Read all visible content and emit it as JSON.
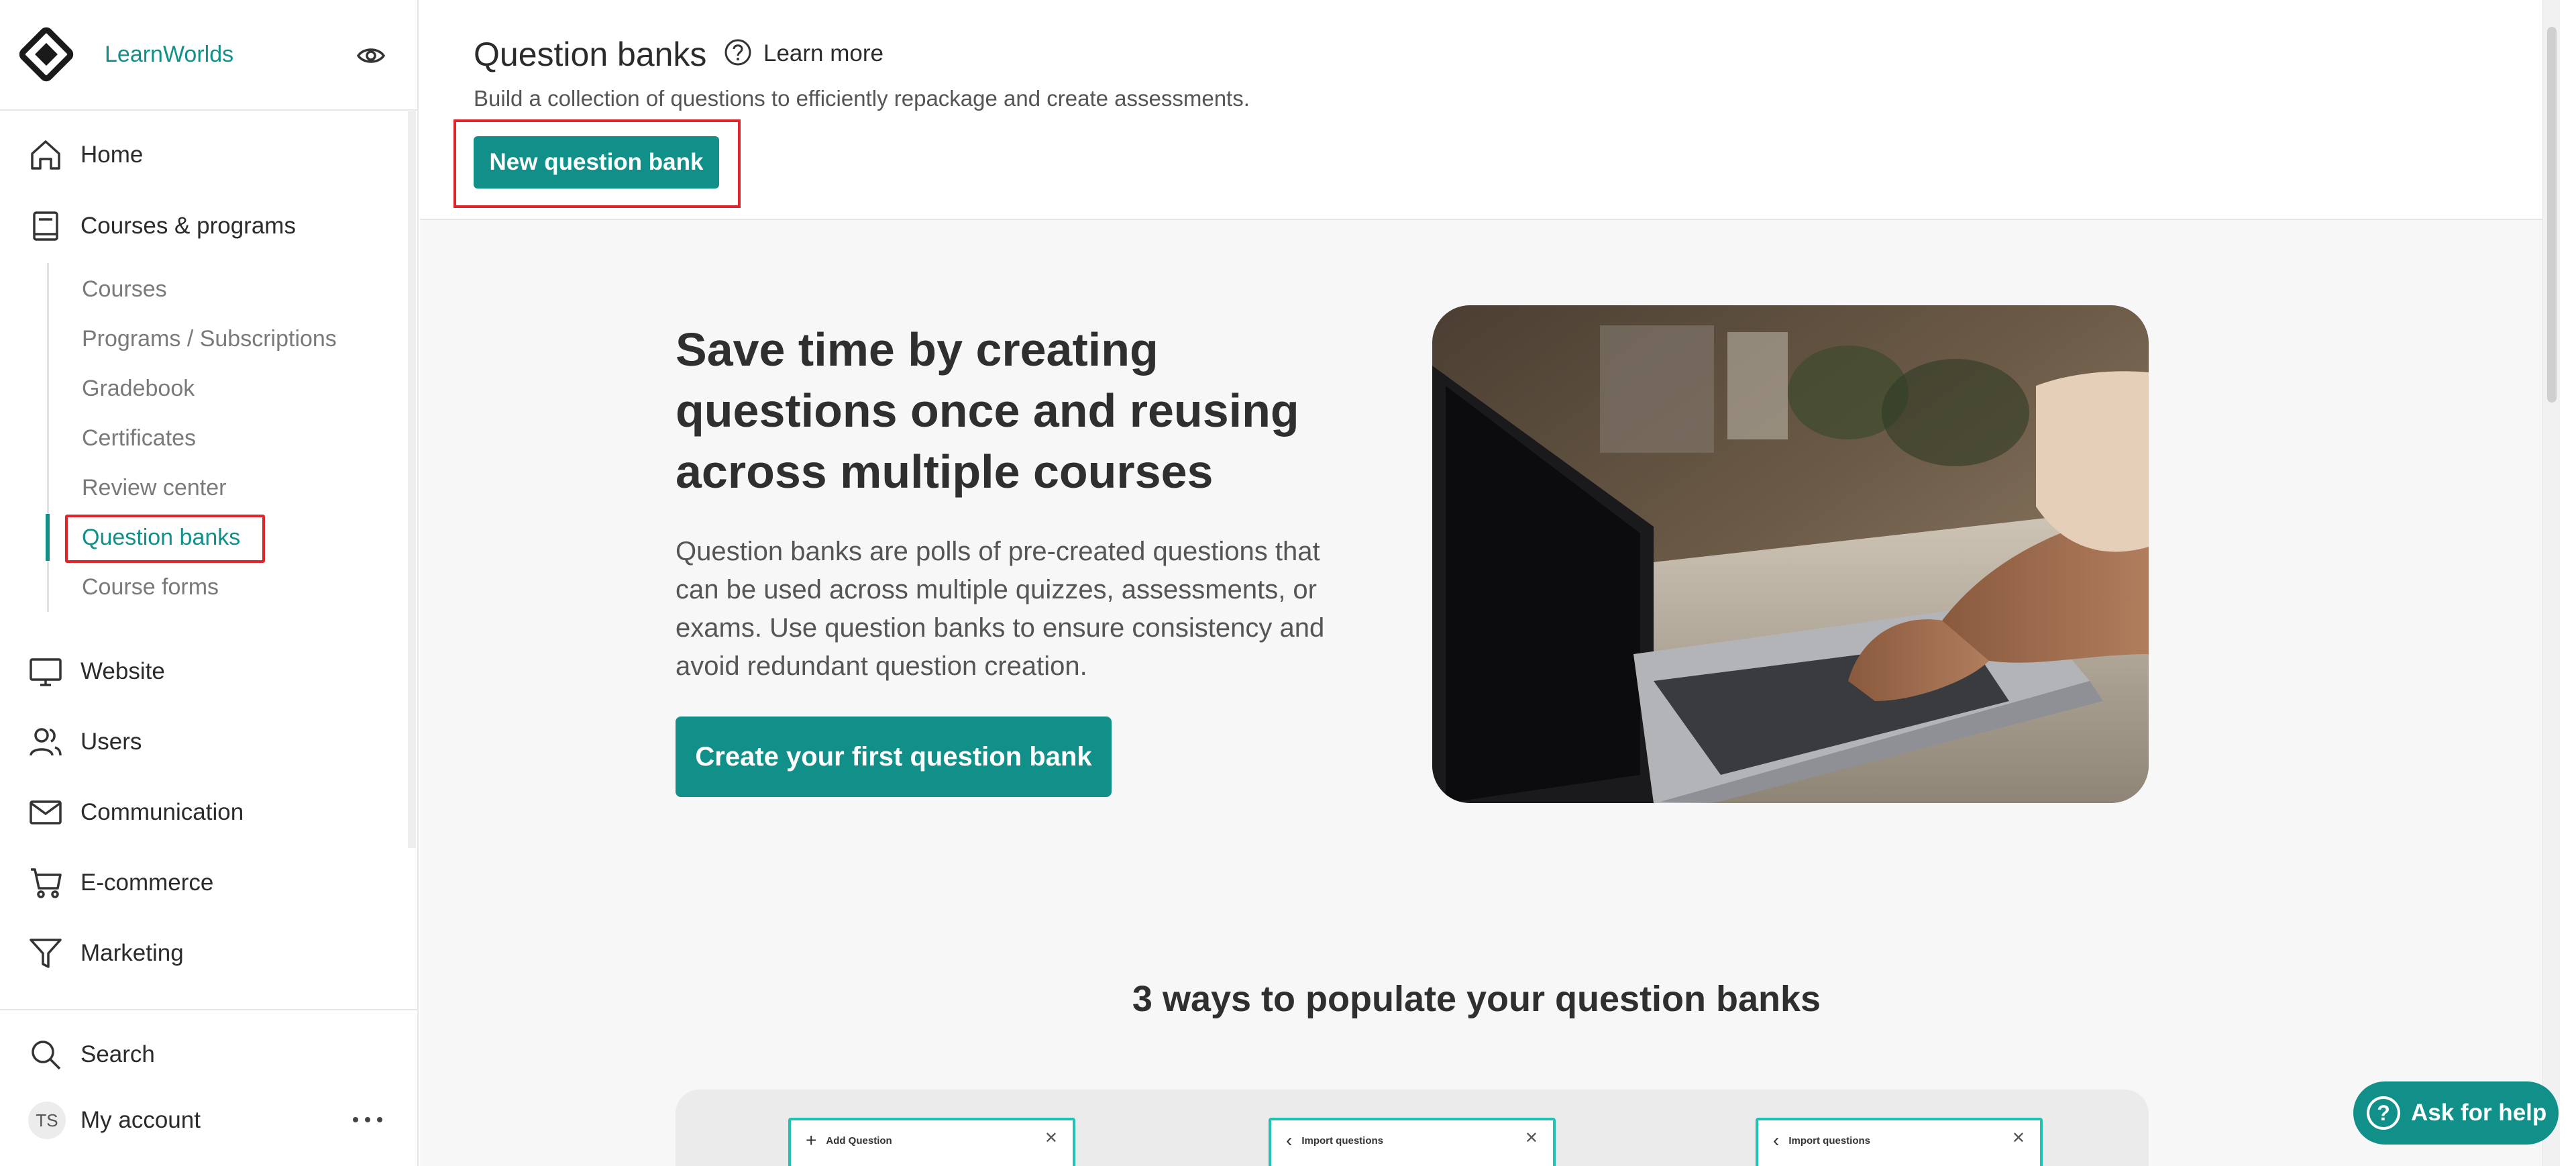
{
  "brand": {
    "name": "LearnWorlds",
    "accent": "#11908a"
  },
  "sidebar": {
    "nav": [
      {
        "label": "Home",
        "icon": "home-icon"
      },
      {
        "label": "Courses & programs",
        "icon": "book-icon"
      },
      {
        "label": "Website",
        "icon": "monitor-icon"
      },
      {
        "label": "Users",
        "icon": "users-icon"
      },
      {
        "label": "Communication",
        "icon": "mail-icon"
      },
      {
        "label": "E-commerce",
        "icon": "cart-icon"
      },
      {
        "label": "Marketing",
        "icon": "funnel-icon"
      }
    ],
    "sub_items": [
      "Courses",
      "Programs / Subscriptions",
      "Gradebook",
      "Certificates",
      "Review center",
      "Question banks",
      "Course forms"
    ],
    "active_sub_item": "Question banks",
    "bottom": {
      "search": "Search",
      "account": "My account",
      "avatar_initials": "TS"
    }
  },
  "header": {
    "title": "Question banks",
    "learn_more": "Learn more",
    "subtitle": "Build a collection of questions to efficiently repackage and create assessments.",
    "new_button": "New question bank"
  },
  "hero": {
    "title": "Save time by creating questions once and reusing across multiple courses",
    "text": "Question banks are polls of pre-created questions that can be used across multiple quizzes, assessments, or exams. Use question banks to ensure consistency and avoid redundant question creation.",
    "button": "Create your first question bank"
  },
  "ways": {
    "title": "3 ways to populate your question banks",
    "cards": [
      {
        "title": "Add Question",
        "icon": "plus-icon"
      },
      {
        "title": "Import questions",
        "icon": "chevron-left-icon"
      },
      {
        "title": "Import questions",
        "icon": "chevron-left-icon"
      }
    ]
  },
  "help": {
    "label": "Ask for help"
  }
}
